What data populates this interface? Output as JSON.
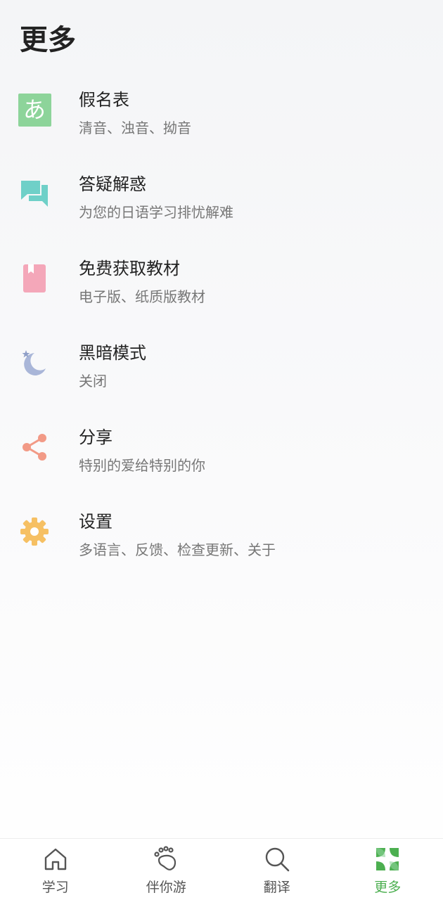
{
  "header": {
    "title": "更多"
  },
  "menu": {
    "items": [
      {
        "title": "假名表",
        "subtitle": "清音、浊音、拗音",
        "icon": "kana-icon",
        "icon_text": "あ",
        "color": "#8dd49a"
      },
      {
        "title": "答疑解惑",
        "subtitle": "为您的日语学习排忧解难",
        "icon": "chat-icon",
        "color": "#6fd0c8"
      },
      {
        "title": "免费获取教材",
        "subtitle": "电子版、纸质版教材",
        "icon": "book-icon",
        "color": "#f4a7b9"
      },
      {
        "title": "黑暗模式",
        "subtitle": "关闭",
        "icon": "moon-icon",
        "color": "#a9b6d8"
      },
      {
        "title": "分享",
        "subtitle": "特别的爱给特别的你",
        "icon": "share-icon",
        "color": "#f29a86"
      },
      {
        "title": "设置",
        "subtitle": "多语言、反馈、检查更新、关于",
        "icon": "gear-icon",
        "color": "#f6c063"
      }
    ]
  },
  "tabbar": {
    "active_color": "#4caf50",
    "tabs": [
      {
        "label": "学习",
        "icon": "home-icon"
      },
      {
        "label": "伴你游",
        "icon": "footprint-icon"
      },
      {
        "label": "翻译",
        "icon": "search-icon"
      },
      {
        "label": "更多",
        "icon": "grid-icon",
        "active": true
      }
    ]
  }
}
